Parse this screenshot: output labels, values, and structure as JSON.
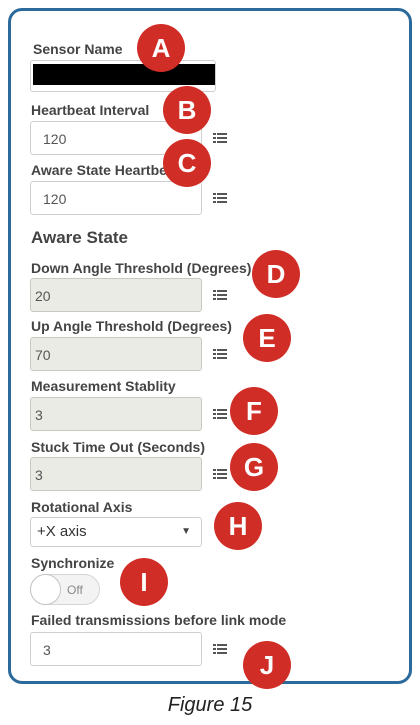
{
  "sensor": {
    "name_label": "Sensor Name",
    "heartbeat_label": "Heartbeat Interval",
    "heartbeat_value": "120",
    "aware_heartbeat_label": "Aware State Heartbeat",
    "aware_heartbeat_value": "120"
  },
  "aware_state": {
    "title": "Aware State",
    "down_angle_label": "Down Angle Threshold (Degrees)",
    "down_angle_value": "20",
    "up_angle_label": "Up Angle Threshold (Degrees)",
    "up_angle_value": "70",
    "stability_label": "Measurement Stablity",
    "stability_value": "3",
    "stuck_label": "Stuck Time Out (Seconds)",
    "stuck_value": "3",
    "axis_label": "Rotational Axis",
    "axis_value": "+X axis",
    "sync_label": "Synchronize",
    "sync_state": "Off",
    "failed_label": "Failed transmissions before link mode",
    "failed_value": "3"
  },
  "markers": [
    "A",
    "B",
    "C",
    "D",
    "E",
    "F",
    "G",
    "H",
    "I",
    "J"
  ],
  "caption": "Figure 15",
  "colors": {
    "border": "#2b6a9a",
    "marker": "#d12d27",
    "readonly_field": "#ebebe6"
  }
}
